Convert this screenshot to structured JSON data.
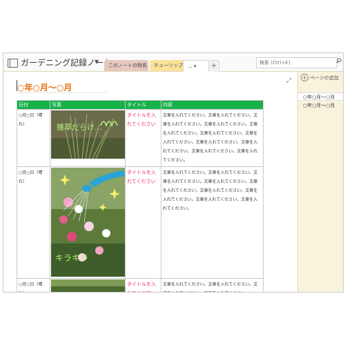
{
  "app": {
    "notebook_title": "ガーデニング記録ノート",
    "tabs": [
      {
        "label": "このノートの特長"
      },
      {
        "label": "チューリップ"
      },
      {
        "label": "..."
      },
      {
        "label": "+"
      }
    ],
    "search_placeholder": "検索 (Ctrl+E)"
  },
  "page": {
    "title": "○年○月～○月",
    "table": {
      "headers": [
        "日付",
        "写真",
        "タイトル",
        "内容"
      ],
      "rows": [
        {
          "date": "○月○日（晴れ）",
          "photo": "grass-photo",
          "photo_caption": "雑草だらけ…",
          "title": "タイトルを入れてください",
          "content": "文章を入れてください。文章を入れてください。文章を入れてください。文章を入れてください。文章を入れてください。文章を入れてください。文章を入れてください。文章を入れてください。文章を入れてください。文章を入れてください。文章を入れてください。"
        },
        {
          "date": "○月○日（晴れ）",
          "photo": "watering-photo",
          "photo_caption": "キラキラ",
          "title": "タイトルを入れてください",
          "content": "文章を入れてください。文章を入れてください。文章を入れてください。文章を入れてください。文章を入れてください。文章を入れてください。文章を入れてください。文章を入れてください。文章を入れてください。"
        },
        {
          "date": "○月○日（晴れ）",
          "photo": "field-photo",
          "photo_caption": "",
          "title": "タイトルを入れてください",
          "content": "文章を入れてください。文章を入れてください。文章を入れてください。文章を入れてください。"
        }
      ]
    }
  },
  "sidebar": {
    "add_page": "ページの追加",
    "pages": [
      "○年○月～○月",
      "○年○月～○月"
    ]
  },
  "colors": {
    "header_green": "#17b14a",
    "title_orange": "#e26b0a",
    "title_pink": "#e9336b",
    "tab_active": "#fbe29a",
    "sidebar_bg": "#faf3dc"
  },
  "icons": [
    "notebook-icon",
    "search-icon",
    "expand-icon",
    "add-page-icon"
  ]
}
